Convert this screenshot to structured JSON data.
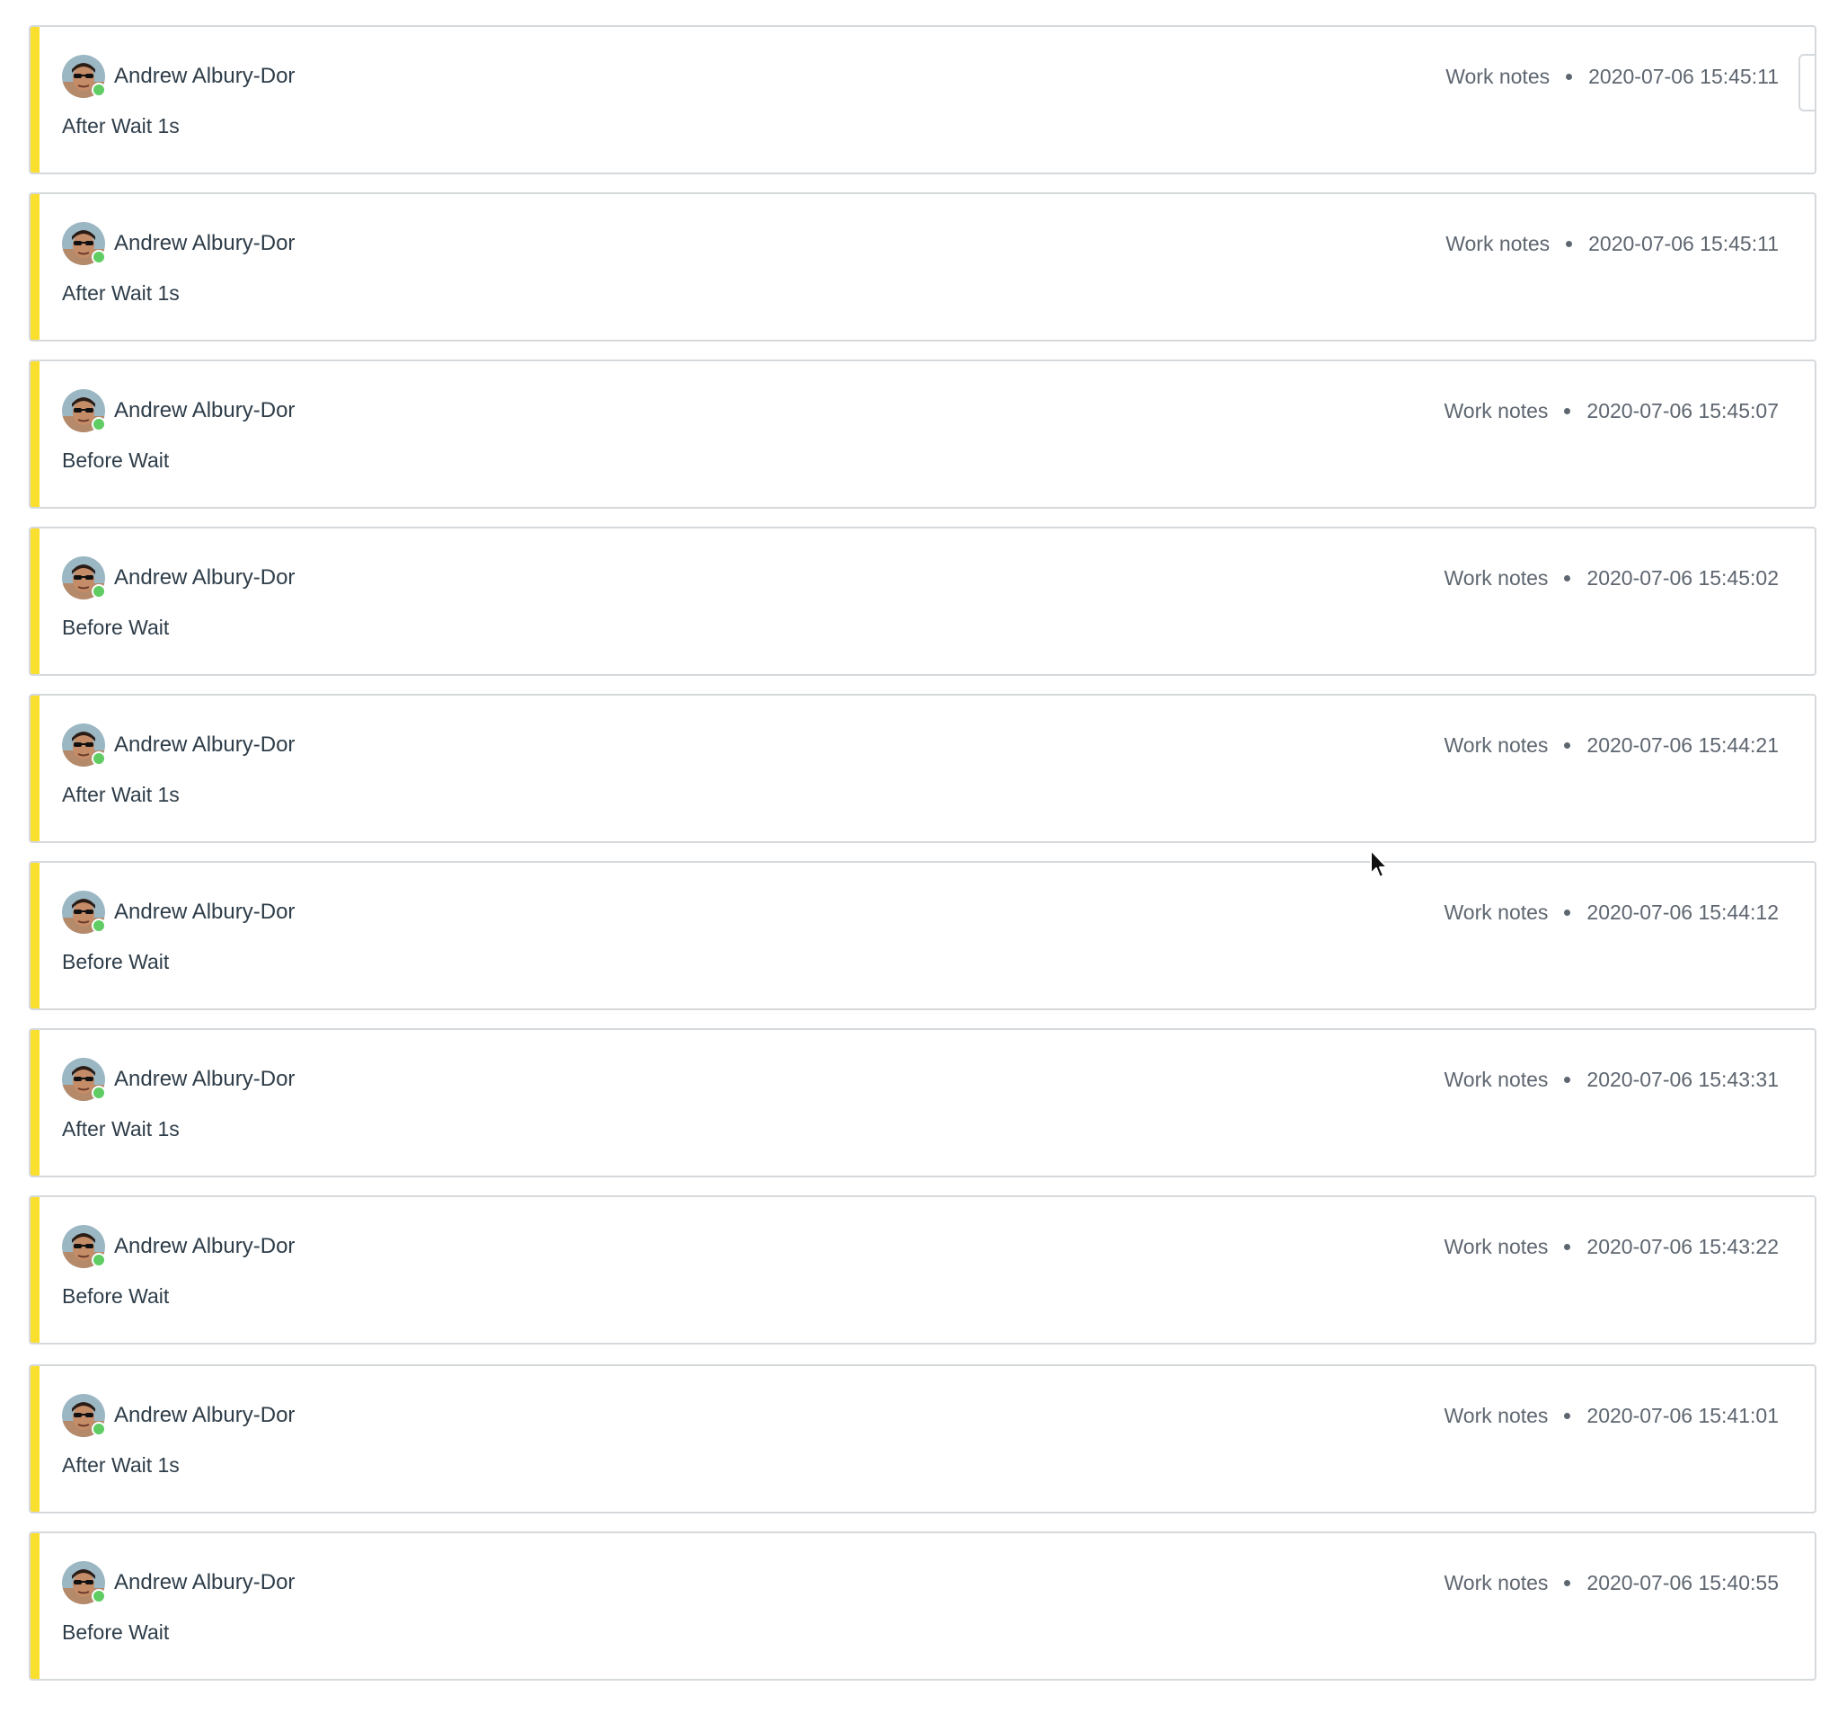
{
  "activity_stream": {
    "entries": [
      {
        "author": "Andrew Albury-Dor",
        "type": "Work notes",
        "timestamp": "2020-07-06 15:45:11",
        "text": "After Wait 1s"
      },
      {
        "author": "Andrew Albury-Dor",
        "type": "Work notes",
        "timestamp": "2020-07-06 15:45:11",
        "text": "After Wait 1s"
      },
      {
        "author": "Andrew Albury-Dor",
        "type": "Work notes",
        "timestamp": "2020-07-06 15:45:07",
        "text": "Before Wait"
      },
      {
        "author": "Andrew Albury-Dor",
        "type": "Work notes",
        "timestamp": "2020-07-06 15:45:02",
        "text": "Before Wait"
      },
      {
        "author": "Andrew Albury-Dor",
        "type": "Work notes",
        "timestamp": "2020-07-06 15:44:21",
        "text": "After Wait 1s"
      },
      {
        "author": "Andrew Albury-Dor",
        "type": "Work notes",
        "timestamp": "2020-07-06 15:44:12",
        "text": "Before Wait"
      },
      {
        "author": "Andrew Albury-Dor",
        "type": "Work notes",
        "timestamp": "2020-07-06 15:43:31",
        "text": "After Wait 1s"
      },
      {
        "author": "Andrew Albury-Dor",
        "type": "Work notes",
        "timestamp": "2020-07-06 15:43:22",
        "text": "Before Wait"
      },
      {
        "author": "Andrew Albury-Dor",
        "type": "Work notes",
        "timestamp": "2020-07-06 15:41:01",
        "text": "After Wait 1s"
      },
      {
        "author": "Andrew Albury-Dor",
        "type": "Work notes",
        "timestamp": "2020-07-06 15:40:55",
        "text": "Before Wait"
      }
    ]
  },
  "colors": {
    "work_notes_accent": "#fbdf2f",
    "presence_online": "#5fcd63",
    "card_border": "#d6d9dc",
    "text_primary": "#2e3d49",
    "text_secondary": "#5e6670"
  },
  "icons": {
    "avatar": "user-avatar-photo",
    "presence": "online-status-dot",
    "separator": "bullet-dot",
    "cursor": "mouse-pointer-icon"
  }
}
